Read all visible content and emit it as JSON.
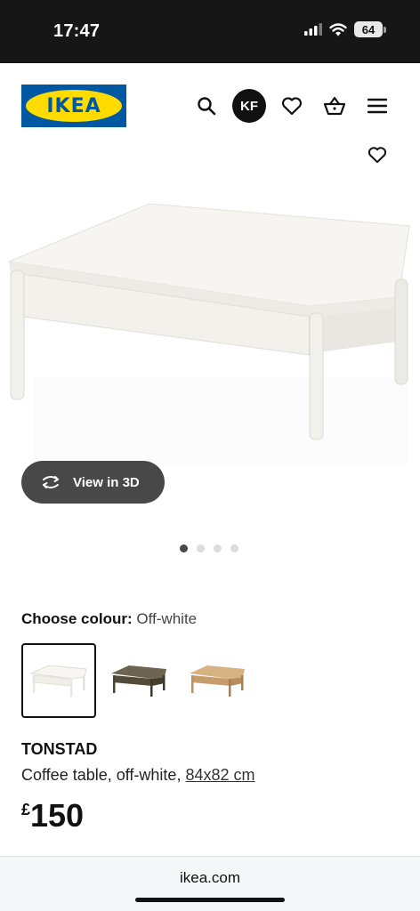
{
  "status_bar": {
    "time": "17:47",
    "battery": "64"
  },
  "header": {
    "logo_text": "IKEA",
    "avatar_initials": "KF"
  },
  "icons": {
    "search": "search-icon",
    "favourites": "heart-icon",
    "basket": "basket-icon",
    "menu": "hamburger-menu-icon",
    "rotate": "rotate-3d-icon"
  },
  "gallery": {
    "view3d_label": "View in 3D",
    "image_count": 4,
    "active_index": 0
  },
  "colour": {
    "label": "Choose colour:",
    "selected": "Off-white",
    "options": [
      {
        "name": "Off-white",
        "color": "#f4f2ec"
      },
      {
        "name": "Dark brown",
        "color": "#5b5441"
      },
      {
        "name": "Oak veneer",
        "color": "#c9a071"
      }
    ]
  },
  "product": {
    "name": "TONSTAD",
    "description": "Coffee table, off-white,",
    "dimensions": "84x82 cm",
    "price_currency": "£",
    "price_value": "150"
  },
  "browser": {
    "url": "ikea.com"
  }
}
